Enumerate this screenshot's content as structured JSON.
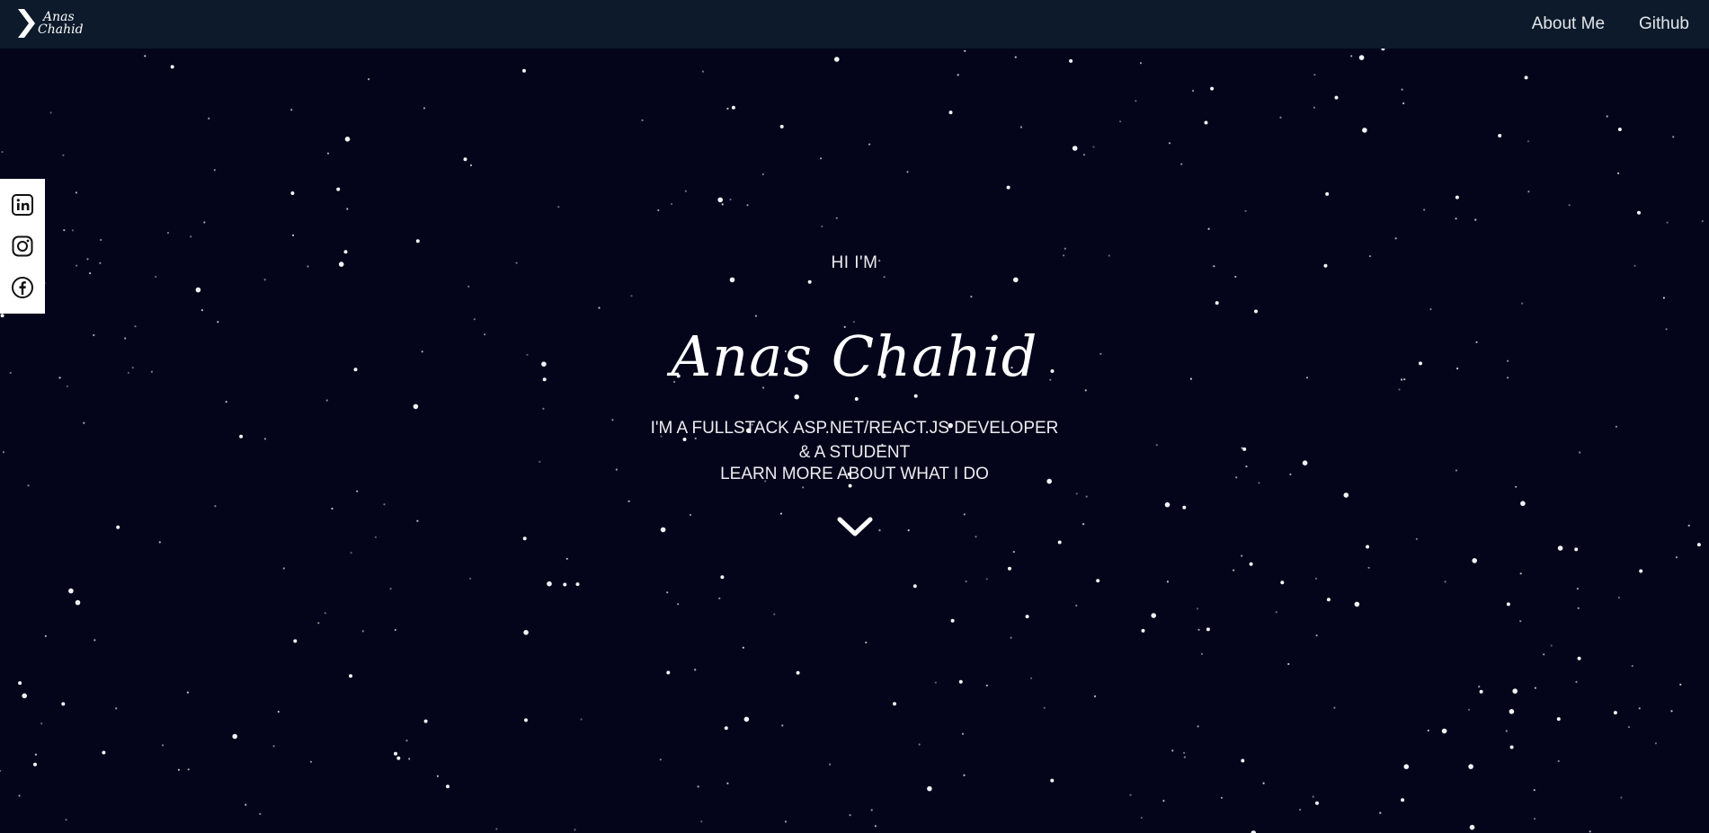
{
  "header": {
    "logo": {
      "line1": "Anas",
      "line2": "Chahid",
      "icon": "chevron-right-icon"
    },
    "nav": [
      {
        "label": "About Me"
      },
      {
        "label": "Github"
      }
    ]
  },
  "social": [
    {
      "icon": "linkedin-icon"
    },
    {
      "icon": "instagram-icon"
    },
    {
      "icon": "facebook-icon"
    }
  ],
  "hero": {
    "greeting": "HI I'M",
    "name": "Anas Chahid",
    "tagline": "I'M A FULLSTACK ASP.NET/REACT.JS DEVELOPER & A STUDENT",
    "learn_more": "LEARN MORE ABOUT WHAT I DO",
    "scroll_icon": "chevron-down-icon"
  },
  "colors": {
    "background": "#04051a",
    "navbar": "#0c1a2b",
    "text": "#ecedf1",
    "sidebar": "#ffffff"
  }
}
